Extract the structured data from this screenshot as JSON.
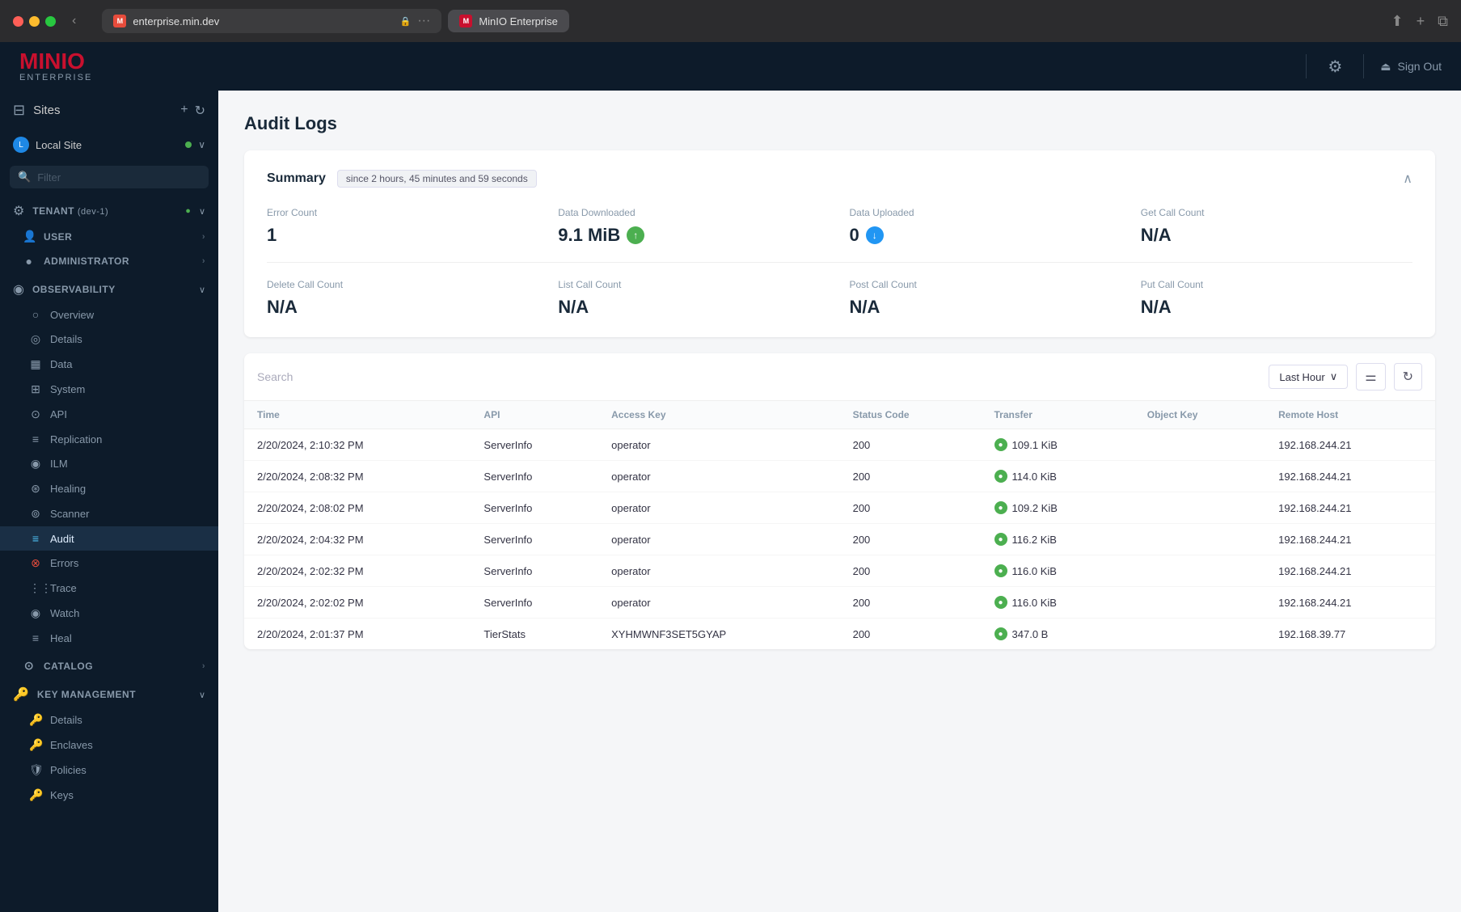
{
  "browser": {
    "tab_url": "enterprise.min.dev",
    "tab_brand": "MinIO Enterprise",
    "back_btn": "‹"
  },
  "topnav": {
    "logo_minio": "MINI",
    "logo_o": "O",
    "logo_enterprise": "ENTERPRISE",
    "sign_out": "Sign Out"
  },
  "sidebar": {
    "sites_label": "Sites",
    "local_site": "Local Site",
    "filter_placeholder": "Filter",
    "tenant_label": "TENANT",
    "tenant_env": "(dev-1)",
    "user_label": "USER",
    "administrator_label": "ADMINISTRATOR",
    "observability_label": "OBSERVABILITY",
    "observability_items": [
      {
        "label": "Overview",
        "icon": "○"
      },
      {
        "label": "Details",
        "icon": "◎"
      },
      {
        "label": "Data",
        "icon": "▦"
      },
      {
        "label": "System",
        "icon": "⊞"
      },
      {
        "label": "API",
        "icon": "⊙"
      },
      {
        "label": "Replication",
        "icon": "≡"
      },
      {
        "label": "ILM",
        "icon": "◉"
      },
      {
        "label": "Healing",
        "icon": "⊛"
      },
      {
        "label": "Scanner",
        "icon": "⊚"
      },
      {
        "label": "Audit",
        "icon": "≡",
        "active": true
      },
      {
        "label": "Errors",
        "icon": "⊗"
      },
      {
        "label": "Trace",
        "icon": "⋮⋮"
      },
      {
        "label": "Watch",
        "icon": "◉"
      },
      {
        "label": "Heal",
        "icon": "≡"
      }
    ],
    "catalog_label": "CATALOG",
    "key_management_label": "KEY MANAGEMENT",
    "key_management_items": [
      {
        "label": "Details",
        "icon": "🔑"
      },
      {
        "label": "Enclaves",
        "icon": "🔑"
      },
      {
        "label": "Policies",
        "icon": "🛡"
      },
      {
        "label": "Keys",
        "icon": "🔑"
      }
    ]
  },
  "content": {
    "page_title": "Audit Logs",
    "summary": {
      "title": "Summary",
      "badge": "since 2 hours, 45 minutes and 59 seconds",
      "metrics_row1": [
        {
          "label": "Error Count",
          "value": "1",
          "arrow": null
        },
        {
          "label": "Data Downloaded",
          "value": "9.1 MiB",
          "arrow": "up"
        },
        {
          "label": "Data Uploaded",
          "value": "0",
          "arrow": "down"
        },
        {
          "label": "Get Call Count",
          "value": "N/A",
          "arrow": null
        }
      ],
      "metrics_row2": [
        {
          "label": "Delete Call Count",
          "value": "N/A",
          "arrow": null
        },
        {
          "label": "List Call Count",
          "value": "N/A",
          "arrow": null
        },
        {
          "label": "Post Call Count",
          "value": "N/A",
          "arrow": null
        },
        {
          "label": "Put Call Count",
          "value": "N/A",
          "arrow": null
        }
      ]
    },
    "log_toolbar": {
      "search_placeholder": "Search",
      "time_filter": "Last Hour",
      "chevron": "∨"
    },
    "table": {
      "columns": [
        "Time",
        "API",
        "Access Key",
        "Status Code",
        "Transfer",
        "Object Key",
        "Remote Host"
      ],
      "rows": [
        {
          "time": "2/20/2024, 2:10:32 PM",
          "api": "ServerInfo",
          "access_key": "operator",
          "status": "200",
          "transfer": "109.1 KiB",
          "transfer_color": "green",
          "object_key": "",
          "remote_host": "192.168.244.21"
        },
        {
          "time": "2/20/2024, 2:08:32 PM",
          "api": "ServerInfo",
          "access_key": "operator",
          "status": "200",
          "transfer": "114.0 KiB",
          "transfer_color": "green",
          "object_key": "",
          "remote_host": "192.168.244.21"
        },
        {
          "time": "2/20/2024, 2:08:02 PM",
          "api": "ServerInfo",
          "access_key": "operator",
          "status": "200",
          "transfer": "109.2 KiB",
          "transfer_color": "green",
          "object_key": "",
          "remote_host": "192.168.244.21"
        },
        {
          "time": "2/20/2024, 2:04:32 PM",
          "api": "ServerInfo",
          "access_key": "operator",
          "status": "200",
          "transfer": "116.2 KiB",
          "transfer_color": "green",
          "object_key": "",
          "remote_host": "192.168.244.21"
        },
        {
          "time": "2/20/2024, 2:02:32 PM",
          "api": "ServerInfo",
          "access_key": "operator",
          "status": "200",
          "transfer": "116.0 KiB",
          "transfer_color": "green",
          "object_key": "",
          "remote_host": "192.168.244.21"
        },
        {
          "time": "2/20/2024, 2:02:02 PM",
          "api": "ServerInfo",
          "access_key": "operator",
          "status": "200",
          "transfer": "116.0 KiB",
          "transfer_color": "green",
          "object_key": "",
          "remote_host": "192.168.244.21"
        },
        {
          "time": "2/20/2024, 2:01:37 PM",
          "api": "TierStats",
          "access_key": "XYHMWNF3SET5GYAP",
          "status": "200",
          "transfer": "347.0 B",
          "transfer_color": "green",
          "object_key": "",
          "remote_host": "192.168.39.77"
        }
      ]
    }
  }
}
